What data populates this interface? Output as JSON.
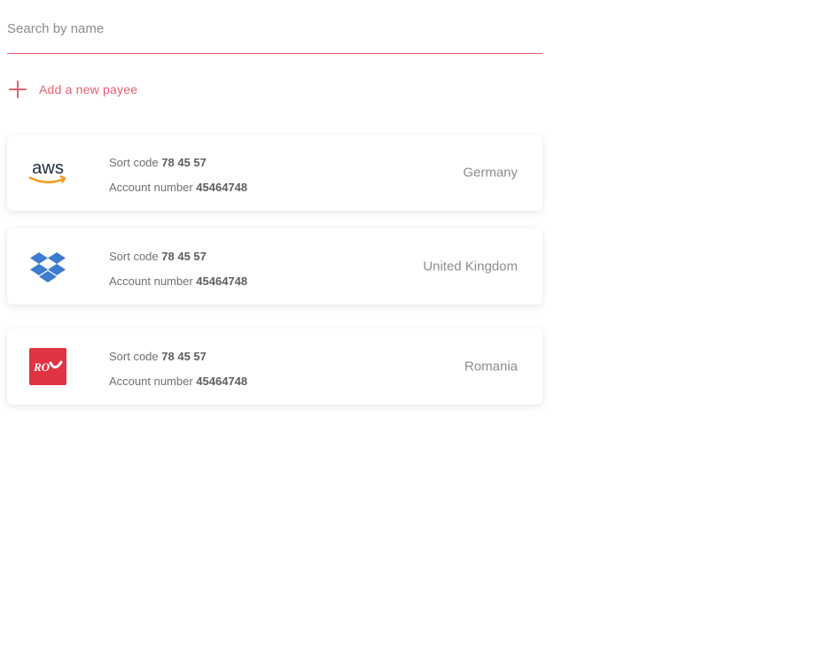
{
  "search": {
    "placeholder": "Search by name",
    "value": ""
  },
  "add_payee": {
    "label": "Add a new payee",
    "icon": "plus-icon",
    "color": "#e8606e"
  },
  "payees": [
    {
      "logo": "aws-logo",
      "sort_code_label": "Sort code",
      "sort_code": "78 45 57",
      "account_label": "Account number",
      "account_number": "45464748",
      "country": "Germany"
    },
    {
      "logo": "dropbox-logo",
      "sort_code_label": "Sort code",
      "sort_code": "78 45 57",
      "account_label": "Account number",
      "account_number": "45464748",
      "country": "United Kingdom"
    },
    {
      "logo": "posta-romana-logo",
      "sort_code_label": "Sort code",
      "sort_code": "78 45 57",
      "account_label": "Account number",
      "account_number": "45464748",
      "country": "Romania"
    }
  ]
}
